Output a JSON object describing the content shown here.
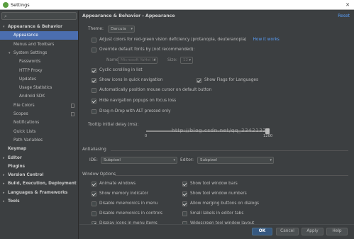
{
  "window": {
    "title": "Settings",
    "close_glyph": "✕"
  },
  "search": {
    "placeholder": ""
  },
  "sidebar": {
    "items": [
      {
        "label": "Appearance & Behavior",
        "level": 0,
        "bold": true,
        "expanded": true
      },
      {
        "label": "Appearance",
        "level": 1,
        "selected": true
      },
      {
        "label": "Menus and Toolbars",
        "level": 1
      },
      {
        "label": "System Settings",
        "level": 1,
        "expanded": true
      },
      {
        "label": "Passwords",
        "level": 2
      },
      {
        "label": "HTTP Proxy",
        "level": 2
      },
      {
        "label": "Updates",
        "level": 2
      },
      {
        "label": "Usage Statistics",
        "level": 2
      },
      {
        "label": "Android SDK",
        "level": 2
      },
      {
        "label": "File Colors",
        "level": 1,
        "copy_icon": true
      },
      {
        "label": "Scopes",
        "level": 1,
        "copy_icon": true
      },
      {
        "label": "Notifications",
        "level": 1
      },
      {
        "label": "Quick Lists",
        "level": 1
      },
      {
        "label": "Path Variables",
        "level": 1
      },
      {
        "label": "Keymap",
        "level": 0,
        "bold": true
      },
      {
        "label": "Editor",
        "level": 0,
        "bold": true,
        "collapsed": true
      },
      {
        "label": "Plugins",
        "level": 0,
        "bold": true
      },
      {
        "label": "Version Control",
        "level": 0,
        "bold": true,
        "collapsed": true
      },
      {
        "label": "Build, Execution, Deployment",
        "level": 0,
        "bold": true,
        "collapsed": true
      },
      {
        "label": "Languages & Frameworks",
        "level": 0,
        "bold": true,
        "collapsed": true
      },
      {
        "label": "Tools",
        "level": 0,
        "bold": true,
        "collapsed": true
      }
    ]
  },
  "main": {
    "breadcrumb": "Appearance & Behavior › Appearance",
    "reset_label": "Reset",
    "theme_label": "Theme:",
    "theme_value": "Darcula",
    "adjust_colors_label": "Adjust colors for red-green vision deficiency (protanopia, deuteranopia)",
    "how_it_works_label": "How it works",
    "override_fonts_label": "Override default fonts by (not recommended):",
    "name_label": "Name:",
    "name_value": "Microsoft YaHei UI",
    "size_label": "Size:",
    "size_value": "12",
    "cyclic_label": "Cyclic scrolling in list",
    "show_icons_label": "Show icons in quick navigation",
    "show_flags_label": "Show Flags for Languages",
    "auto_position_label": "Automatically position mouse cursor on default button",
    "hide_popups_label": "Hide navigation popups on focus loss",
    "drag_drop_label": "Drag-n-Drop with ALT pressed only",
    "tooltip_label": "Tooltip initial delay (ms):",
    "tooltip_min": "0",
    "tooltip_max": "1200",
    "tooltip_fraction": 0.985,
    "watermark": "http://blog.csdn.net/qq_33421320",
    "antialiasing_title": "Antialiasing",
    "ide_label": "IDE:",
    "ide_value": "Subpixel",
    "editor_label": "Editor:",
    "editor_value": "Subpixel",
    "window_options_title": "Window Options",
    "animate_windows_label": "Animate windows",
    "show_memory_label": "Show memory indicator",
    "disable_mnemonics_menu_label": "Disable mnemonics in menu",
    "disable_mnemonics_controls_label": "Disable mnemonics in controls",
    "display_icons_menu_label": "Display icons in menu items",
    "show_tool_bars_label": "Show tool window bars",
    "show_tool_numbers_label": "Show tool window numbers",
    "allow_merging_label": "Allow merging buttons on dialogs",
    "small_labels_label": "Small labels in editor tabs",
    "widescreen_label": "Widescreen tool window layout"
  },
  "footer": {
    "ok_label": "OK",
    "cancel_label": "Cancel",
    "apply_label": "Apply",
    "help_label": "Help"
  },
  "colors": {
    "background": "#3c3f41",
    "selection": "#4b6eaf",
    "link": "#589df6",
    "primary_button": "#365880"
  }
}
